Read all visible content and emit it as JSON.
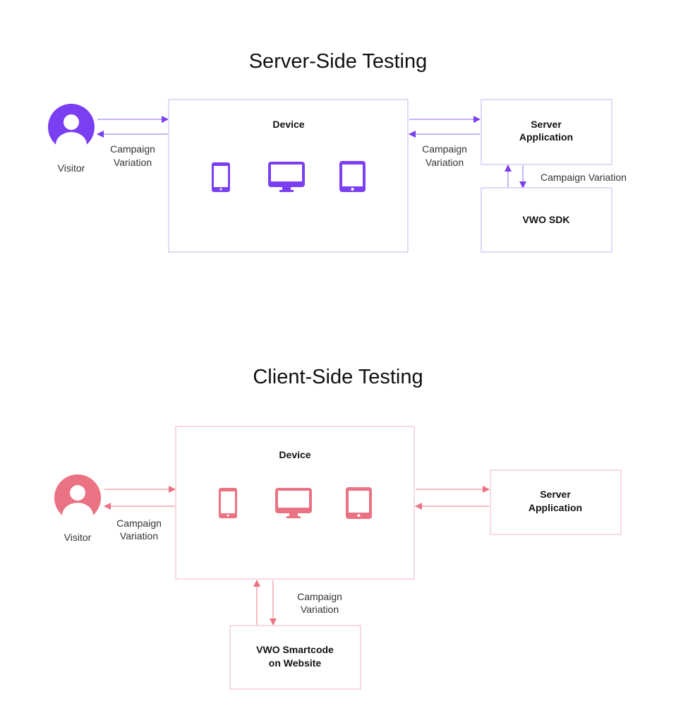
{
  "colors": {
    "server_accent": "#7b3ff2",
    "server_border": "#d9ccf7",
    "client_accent": "#ea7282",
    "client_border": "#f5cdd3"
  },
  "server_side": {
    "title": "Server-Side Testing",
    "visitor_label": "Visitor",
    "visitor_arrow_label": [
      "Campaign",
      "Variation"
    ],
    "device_label": "Device",
    "device_icons": [
      "smartphone-icon",
      "desktop-monitor-icon",
      "tablet-icon"
    ],
    "device_server_arrow_label": [
      "Campaign",
      "Variation"
    ],
    "server_label": [
      "Server",
      "Application"
    ],
    "sdk_arrow_label": "Campaign Variation",
    "sdk_label": "VWO SDK"
  },
  "client_side": {
    "title": "Client-Side Testing",
    "visitor_label": "Visitor",
    "visitor_arrow_label": [
      "Campaign",
      "Variation"
    ],
    "device_label": "Device",
    "device_icons": [
      "smartphone-icon",
      "desktop-monitor-icon",
      "tablet-icon"
    ],
    "server_label": [
      "Server",
      "Application"
    ],
    "smartcode_arrow_label": [
      "Campaign",
      "Variation"
    ],
    "smartcode_label": [
      "VWO Smartcode",
      "on Website"
    ]
  }
}
